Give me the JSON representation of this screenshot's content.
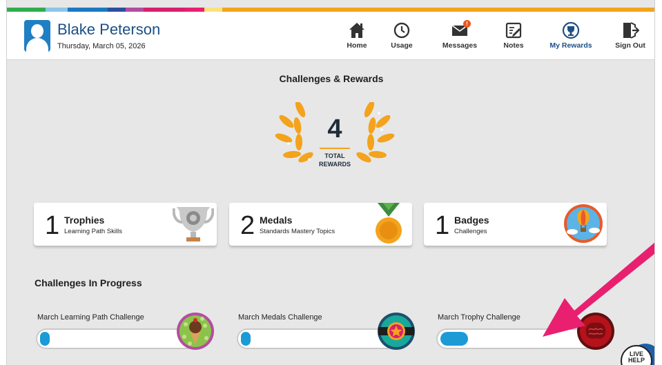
{
  "header": {
    "user_name": "Blake Peterson",
    "date": "Thursday, March 05, 2026"
  },
  "nav": [
    {
      "label": "Home",
      "icon": "home-icon"
    },
    {
      "label": "Usage",
      "icon": "clock-icon"
    },
    {
      "label": "Messages",
      "icon": "envelope-icon",
      "badge": "!"
    },
    {
      "label": "Notes",
      "icon": "notes-icon"
    },
    {
      "label": "My Rewards",
      "icon": "trophy-icon",
      "active": true
    },
    {
      "label": "Sign Out",
      "icon": "sign-out-icon"
    }
  ],
  "main": {
    "title": "Challenges & Rewards",
    "total": {
      "value": "4",
      "label_line1": "TOTAL",
      "label_line2": "REWARDS"
    },
    "rewards": [
      {
        "count": "1",
        "title": "Trophies",
        "subtitle": "Learning Path Skills",
        "icon": "trophy-cup-icon"
      },
      {
        "count": "2",
        "title": "Medals",
        "subtitle": "Standards Mastery Topics",
        "icon": "medal-icon"
      },
      {
        "count": "1",
        "title": "Badges",
        "subtitle": "Challenges",
        "icon": "hot-air-balloon-badge-icon"
      }
    ],
    "in_progress_title": "Challenges In Progress",
    "challenges": [
      {
        "label": "March Learning Path Challenge",
        "progress": 0.05,
        "icon": "ice-cream-badge-icon"
      },
      {
        "label": "March Medals Challenge",
        "progress": 0.05,
        "icon": "star-belt-badge-icon"
      },
      {
        "label": "March Trophy Challenge",
        "progress": 0.18,
        "icon": "brain-badge-icon"
      }
    ],
    "live_help": {
      "line1": "LIVE",
      "line2": "HELP"
    }
  },
  "colors": {
    "accent": "#1c4f86",
    "progress": "#1b9ad6",
    "gold": "#f3a31c",
    "annotation_arrow": "#e8206f",
    "colorbar": [
      "#2fae4d",
      "#8dc6e8",
      "#1a79c2",
      "#2c4f9e",
      "#b44d9f",
      "#d9206f",
      "#e8206f",
      "#f9e27c",
      "#f3a31c"
    ]
  }
}
